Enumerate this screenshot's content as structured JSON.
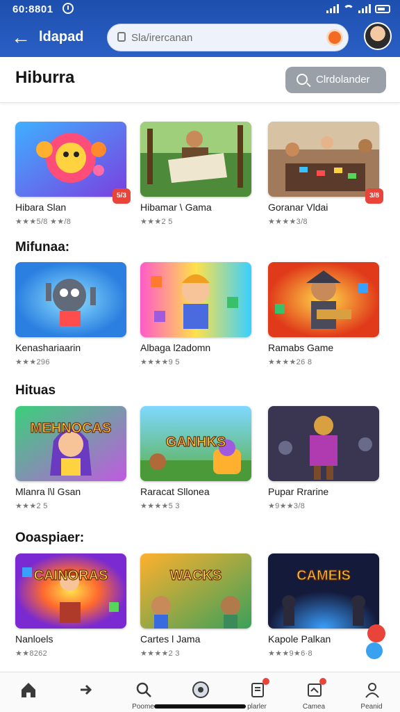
{
  "status": {
    "time": "60:8801"
  },
  "appbar": {
    "title": "ldapad",
    "search_placeholder": "Sla/irercanan"
  },
  "header": {
    "title": "Hiburra",
    "button_label": "Clrdolander"
  },
  "sections": [
    {
      "title": "",
      "cards": [
        {
          "title": "Hibara Slan",
          "rating": "★★★5/8  ★★/8",
          "badge": "5/3",
          "thumb": "emoji"
        },
        {
          "title": "Hibamar \\ Gama",
          "rating": "★★★2 5",
          "badge": "",
          "thumb": "map"
        },
        {
          "title": "Goranar Vldai",
          "rating": "★★★★3/8",
          "badge": "3/8",
          "thumb": "table"
        }
      ]
    },
    {
      "title": "Mifunaa:",
      "cards": [
        {
          "title": "Kenashariaarin",
          "rating": "★★★296",
          "badge": "",
          "thumb": "robot"
        },
        {
          "title": "Albaga l2adomn",
          "rating": "★★★★9 5",
          "badge": "",
          "thumb": "kid"
        },
        {
          "title": "Ramabs Game",
          "rating": "★★★★26 8",
          "badge": "",
          "thumb": "pirate"
        }
      ]
    },
    {
      "title": "Hituas",
      "cards": [
        {
          "title": "Mlanra l\\l Gsan",
          "rating": "★★★2 5",
          "badge": "",
          "thumb": "girl",
          "banner": "MEHNOCAS"
        },
        {
          "title": "Raracat Sllonea",
          "rating": "★★★★5 3",
          "badge": "",
          "thumb": "games",
          "banner": "GANHKS"
        },
        {
          "title": "Pupar Rrarine",
          "rating": "★9★★3/8",
          "badge": "",
          "thumb": "warrior"
        }
      ]
    },
    {
      "title": "Ooaspiaer:",
      "cards": [
        {
          "title": "Nanloels",
          "rating": "★★8262",
          "badge": "",
          "thumb": "burst",
          "banner": "CAINORAS"
        },
        {
          "title": "Cartes l Jama",
          "rating": "★★★★2 3",
          "badge": "",
          "thumb": "wacks",
          "banner": "WACKS"
        },
        {
          "title": "Kapole Palkan",
          "rating": "★★★9★6·8",
          "badge": "",
          "thumb": "dark",
          "banner": "CAMEIS"
        }
      ]
    }
  ],
  "nav": [
    {
      "label": "",
      "icon": "home-icon"
    },
    {
      "label": "",
      "icon": "arrow-icon"
    },
    {
      "label": "Poome",
      "icon": "search-icon"
    },
    {
      "label": "",
      "icon": "record-icon"
    },
    {
      "label": "plarler",
      "icon": "doc-icon"
    },
    {
      "label": "Camea",
      "icon": "doc2-icon"
    },
    {
      "label": "Peanid",
      "icon": "person-icon"
    }
  ],
  "colors": {
    "primary": "#1d4fae",
    "accent": "#e8443a",
    "mic": "#f36b22"
  }
}
